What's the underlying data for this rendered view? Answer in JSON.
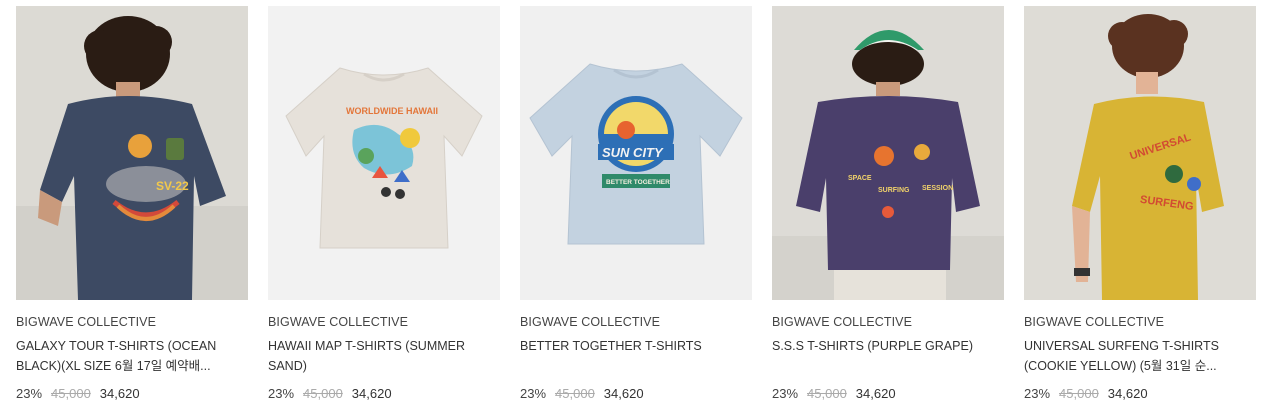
{
  "products": [
    {
      "brand": "BIGWAVE COLLECTIVE",
      "name": "GALAXY TOUR T-SHIRTS (OCEAN BLACK)(XL SIZE 6월 17일 예약배...",
      "discount": "23%",
      "original_price": "45,000",
      "sale_price": "34,620",
      "image_icon": "model-back-navy-tee",
      "colors": {
        "bg": "#dcdad4",
        "shirt": "#3d4a63"
      }
    },
    {
      "brand": "BIGWAVE COLLECTIVE",
      "name": "HAWAII MAP T-SHIRTS (SUMMER SAND)",
      "discount": "23%",
      "original_price": "45,000",
      "sale_price": "34,620",
      "image_icon": "flat-tee-hawaii-map",
      "colors": {
        "bg": "#f2f2f2",
        "shirt": "#e6e1da"
      }
    },
    {
      "brand": "BIGWAVE COLLECTIVE",
      "name": "BETTER TOGETHER T-SHIRTS",
      "discount": "23%",
      "original_price": "45,000",
      "sale_price": "34,620",
      "image_icon": "flat-tee-sun-city",
      "colors": {
        "bg": "#f0f0f0",
        "shirt": "#c3d2e0"
      }
    },
    {
      "brand": "BIGWAVE COLLECTIVE",
      "name": "S.S.S T-SHIRTS (PURPLE GRAPE)",
      "discount": "23%",
      "original_price": "45,000",
      "sale_price": "34,620",
      "image_icon": "model-back-purple-tee",
      "colors": {
        "bg": "#dddbd6",
        "shirt": "#4a3f6b"
      }
    },
    {
      "brand": "BIGWAVE COLLECTIVE",
      "name": "UNIVERSAL SURFENG T-SHIRTS (COOKIE YELLOW) (5월 31일 순...",
      "discount": "23%",
      "original_price": "45,000",
      "sale_price": "34,620",
      "image_icon": "model-side-yellow-tee",
      "colors": {
        "bg": "#dedcd6",
        "shirt": "#d8b434"
      }
    }
  ]
}
